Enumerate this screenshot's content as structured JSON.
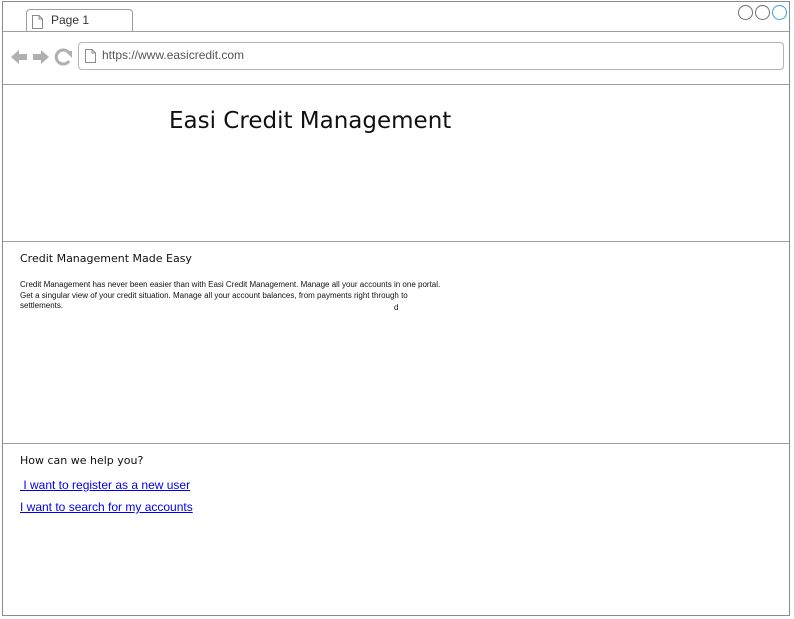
{
  "browser": {
    "tab_label": "Page 1",
    "url": "https://www.easicredit.com"
  },
  "header": {
    "title": "Easi Credit Management"
  },
  "intro": {
    "heading": "Credit Management Made Easy",
    "body": "Credit Management has never been easier than with Easi Credit Management. Manage all your accounts in one portal. Get a singular view of your credit situation. Manage all your account balances, from payments right through to settlements.",
    "stray_char": "d"
  },
  "help": {
    "heading": "How can we help you?",
    "links": [
      {
        "label": " I want to register as a new user"
      },
      {
        "label": "I want to search for my accounts"
      }
    ]
  },
  "colors": {
    "link": "#0000ee",
    "active_control": "#3aa0d8"
  }
}
